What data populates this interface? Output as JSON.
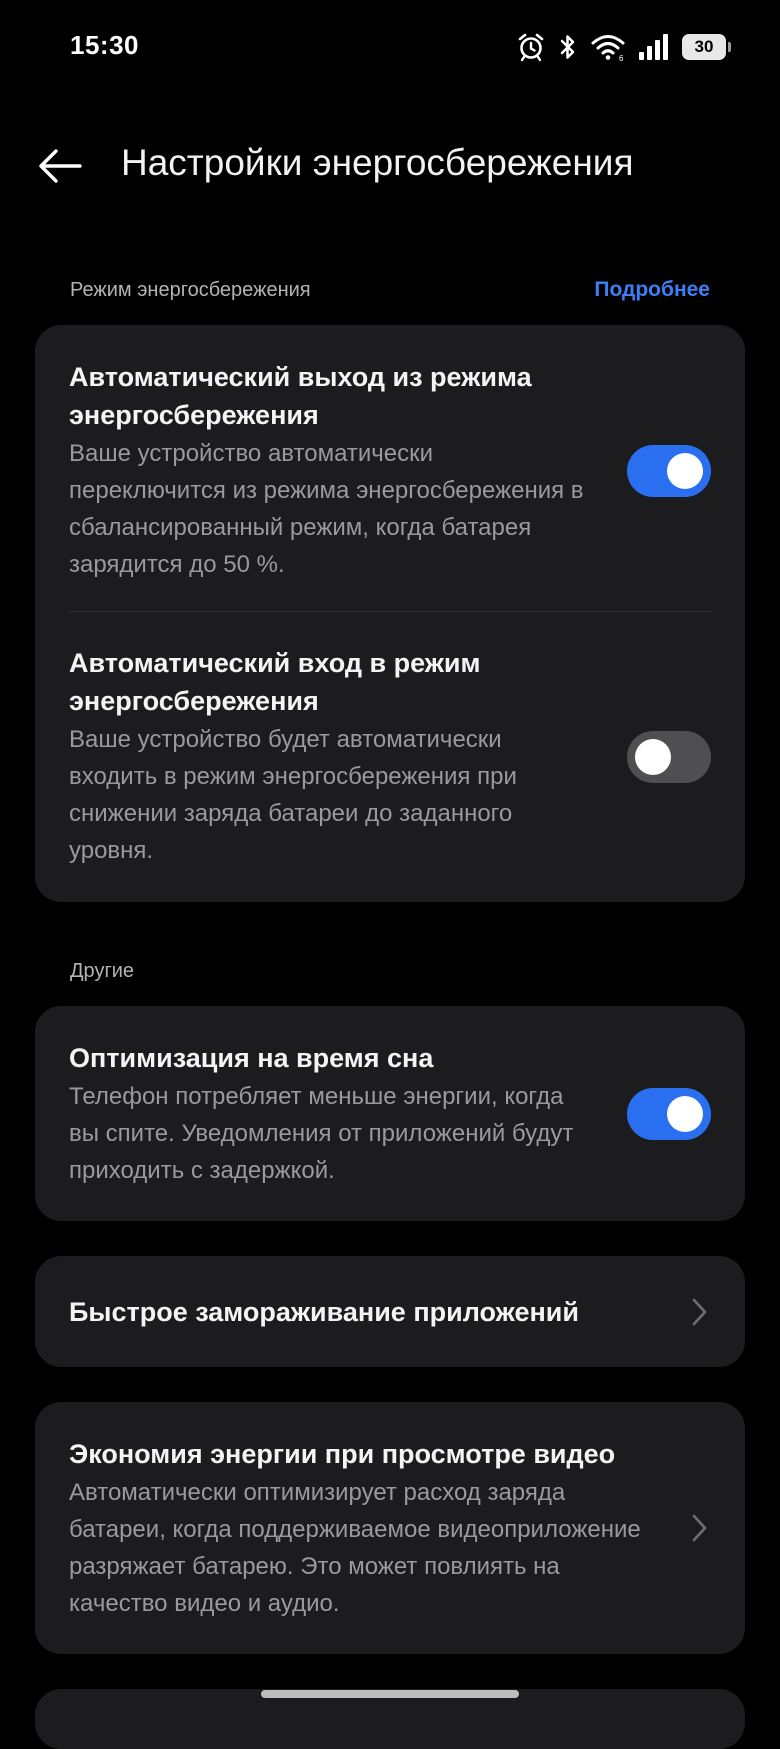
{
  "status_bar": {
    "time": "15:30",
    "battery_level": "30",
    "icons": [
      "alarm-icon",
      "bluetooth-icon",
      "wifi-icon",
      "signal-icon",
      "battery-icon"
    ]
  },
  "header": {
    "title": "Настройки энергосбережения",
    "back_icon": "arrow-left-icon"
  },
  "sections": {
    "power_saving": {
      "title": "Режим энергосбережения",
      "link_label": "Подробнее",
      "link_color": "#3d7ef5",
      "items": [
        {
          "title": "Автоматический выход из режима энергосбережения",
          "description": "Ваше устройство автоматически переключится из режима энергосбережения в сбалансированный режим, когда батарея зарядится до 50 %.",
          "toggle": true
        },
        {
          "title": "Автоматический вход в режим энергосбережения",
          "description": "Ваше устройство будет автоматически входить в режим энергосбережения при снижении заряда батареи до заданного уровня.",
          "toggle": false
        }
      ]
    },
    "other": {
      "title": "Другие",
      "items": [
        {
          "title": "Оптимизация на время сна",
          "description": "Телефон потребляет меньше энергии, когда вы спите. Уведомления от приложений будут приходить с задержкой.",
          "toggle": true
        },
        {
          "title": "Быстрое замораживание приложений",
          "icon": "chevron-right-icon"
        },
        {
          "title": "Экономия энергии при просмотре видео",
          "description": "Автоматически оптимизирует расход заряда батареи, когда поддерживаемое видеоприложение разряжает батарею. Это может повлиять на качество видео и аудио.",
          "icon": "chevron-right-icon"
        }
      ]
    }
  },
  "colors": {
    "background": "#000000",
    "card": "#1c1c1e",
    "toggle_on": "#2a6ff0",
    "toggle_off": "#4f4f51",
    "accent": "#3d7ef5"
  }
}
